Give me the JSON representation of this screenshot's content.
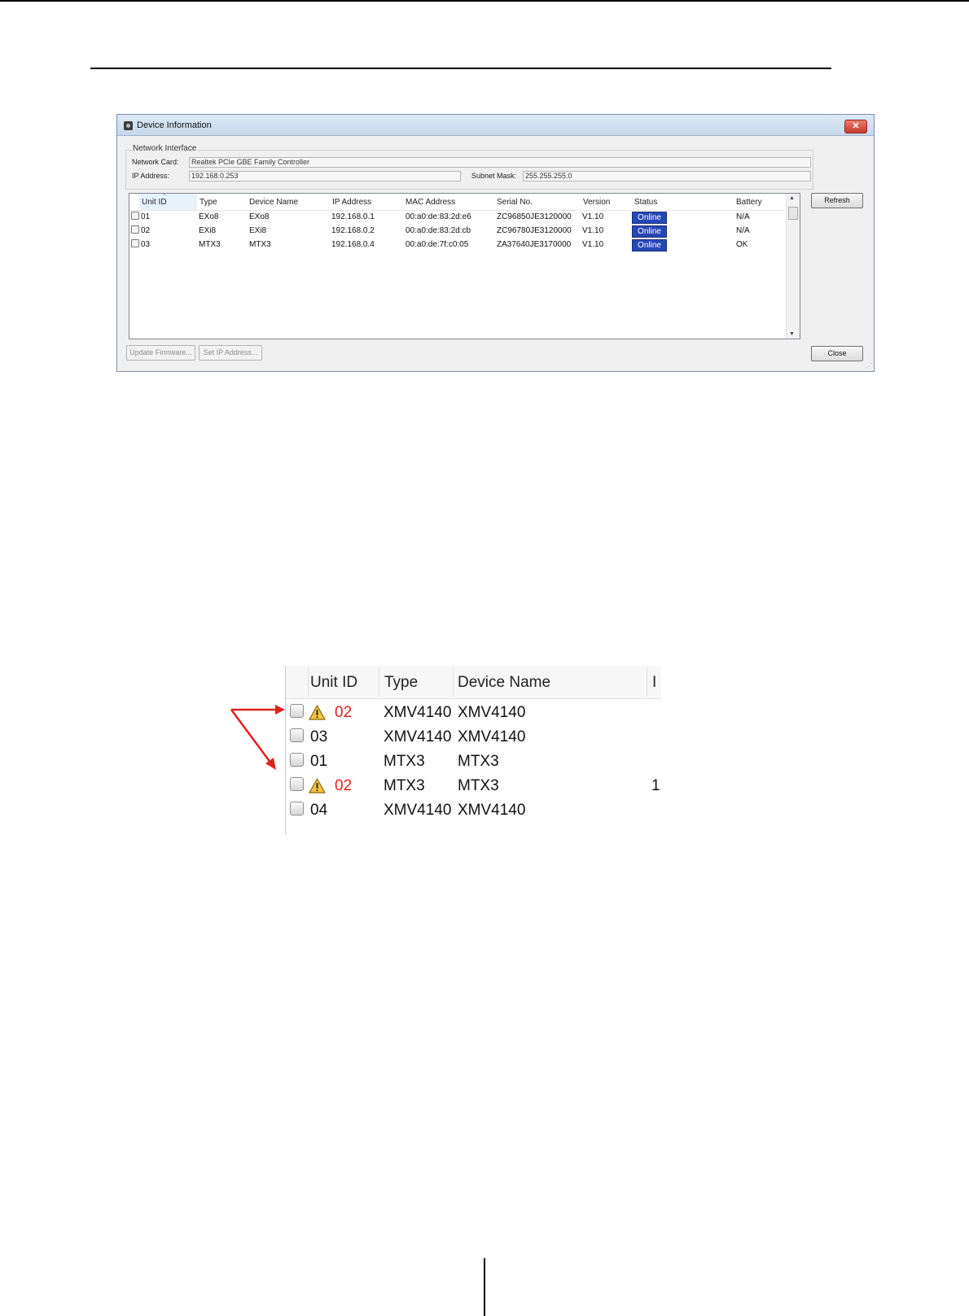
{
  "window": {
    "title": "Device Information",
    "network_interface": {
      "legend": "Network Interface",
      "network_card_label": "Network Card:",
      "network_card_value": "Realtek PCIe GBE Family Controller",
      "ip_address_label": "IP Address:",
      "ip_address_value": "192.168.0.253",
      "subnet_mask_label": "Subnet Mask:",
      "subnet_mask_value": "255.255.255.0"
    },
    "columns": [
      "Unit ID",
      "Type",
      "Device Name",
      "IP Address",
      "MAC Address",
      "Serial No.",
      "Version",
      "Status",
      "Battery"
    ],
    "rows": [
      {
        "unit_id": "01",
        "type": "EXo8",
        "device_name": "EXo8",
        "ip": "192.168.0.1",
        "mac": "00:a0:de:83:2d:e6",
        "serial": "ZC96850JE3120000",
        "version": "V1.10",
        "status": "Online",
        "battery": "N/A"
      },
      {
        "unit_id": "02",
        "type": "EXi8",
        "device_name": "EXi8",
        "ip": "192.168.0.2",
        "mac": "00:a0:de:83:2d:cb",
        "serial": "ZC96780JE3120000",
        "version": "V1.10",
        "status": "Online",
        "battery": "N/A"
      },
      {
        "unit_id": "03",
        "type": "MTX3",
        "device_name": "MTX3",
        "ip": "192.168.0.4",
        "mac": "00:a0:de:7f:c0:05",
        "serial": "ZA37640JE3170000",
        "version": "V1.10",
        "status": "Online",
        "battery": "OK"
      }
    ],
    "buttons": {
      "refresh": "Refresh",
      "close": "Close",
      "update_firmware": "Update Firmware...",
      "set_ip_address": "Set IP Address..."
    },
    "status_color": "#2648b6"
  },
  "zoom": {
    "columns": [
      "Unit ID",
      "Type",
      "Device Name",
      "I"
    ],
    "rows": [
      {
        "unit_id": "02",
        "type": "XMV4140",
        "device_name": "XMV4140",
        "warning": true,
        "extra": ""
      },
      {
        "unit_id": "03",
        "type": "XMV4140",
        "device_name": "XMV4140",
        "warning": false,
        "extra": ""
      },
      {
        "unit_id": "01",
        "type": "MTX3",
        "device_name": "MTX3",
        "warning": false,
        "extra": ""
      },
      {
        "unit_id": "02",
        "type": "MTX3",
        "device_name": "MTX3",
        "warning": true,
        "extra": "1"
      },
      {
        "unit_id": "04",
        "type": "XMV4140",
        "device_name": "XMV4140",
        "warning": false,
        "extra": ""
      }
    ],
    "duplicate_color": "#e02020",
    "arrow_color": "#e02020"
  }
}
